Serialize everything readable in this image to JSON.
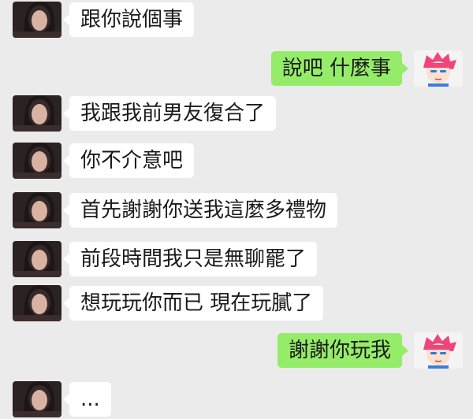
{
  "colors": {
    "background": "#ebebeb",
    "incoming_bubble": "#ffffff",
    "outgoing_bubble": "#95ec69",
    "text": "#1a1a1a"
  },
  "messages": [
    {
      "side": "incoming",
      "text": "跟你說個事",
      "avatar": "girlfriend-avatar"
    },
    {
      "side": "outgoing",
      "text": "說吧 什麼事",
      "avatar": "red-hair-boy-avatar"
    },
    {
      "side": "incoming",
      "text": "我跟我前男友復合了",
      "avatar": "girlfriend-avatar"
    },
    {
      "side": "incoming",
      "text": "你不介意吧",
      "avatar": "girlfriend-avatar"
    },
    {
      "side": "incoming",
      "text": "首先謝謝你送我這麼多禮物",
      "avatar": "girlfriend-avatar"
    },
    {
      "side": "incoming",
      "text": "前段時間我只是無聊罷了",
      "avatar": "girlfriend-avatar"
    },
    {
      "side": "incoming",
      "text": "想玩玩你而已 現在玩膩了",
      "avatar": "girlfriend-avatar"
    },
    {
      "side": "outgoing",
      "text": "謝謝你玩我",
      "avatar": "red-hair-boy-avatar"
    },
    {
      "side": "incoming",
      "text": "...",
      "avatar": "girlfriend-avatar"
    }
  ]
}
